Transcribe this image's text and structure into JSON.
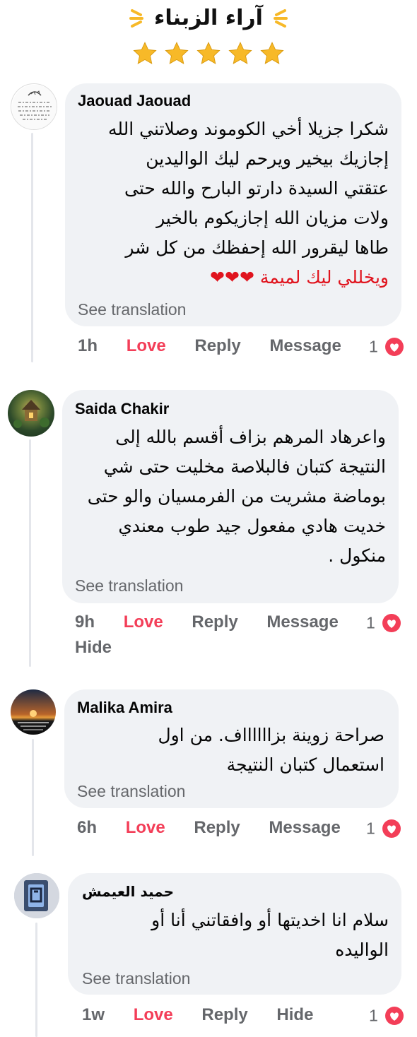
{
  "header": {
    "title": "آراء الزبناء",
    "rating": 5
  },
  "colors": {
    "bubble": "#f0f2f5",
    "love": "#f33e58",
    "meta": "#65676b",
    "star": "#f7b928"
  },
  "comments": [
    {
      "author": "Jaouad Jaouad",
      "lines": [
        "شكرا جزيلا أخي الكوموند وصلاتني الله",
        "إجازيك بيخير ويرحم ليك الواليدين",
        "عتقتي السيدة دارتو البارح والله حتى",
        "ولات مزيان الله إجازيكوم بالخير",
        "طاها ليقرور الله إحفظك من كل شر",
        "ويخللي ليك لميمة ❤❤❤"
      ],
      "see_translation": "See translation",
      "time": "1h",
      "love": "Love",
      "reply": "Reply",
      "message": "Message",
      "count": "1"
    },
    {
      "author": "Saida Chakir",
      "lines": [
        "واعرهاد المرهم بزاف أقسم بالله إلى",
        "النتيجة كتبان فالبلاصة مخليت حتى شي",
        "بوماضة مشريت من الفرمسيان والو حتى",
        "خديت هادي مفعول جيد طوب معندي",
        "منكول ."
      ],
      "see_translation": "See translation",
      "time": "9h",
      "love": "Love",
      "reply": "Reply",
      "message": "Message",
      "hide": "Hide",
      "count": "1"
    },
    {
      "author": "Malika Amira",
      "lines": [
        "صراحة زوينة بزااااااف. من اول",
        "استعمال كتبان النتيجة"
      ],
      "see_translation": "See translation",
      "time": "6h",
      "love": "Love",
      "reply": "Reply",
      "message": "Message",
      "count": "1"
    },
    {
      "author": "حميد العيمش",
      "lines": [
        "سلام انا اخديتها أو وافقاتني أنا أو",
        "الواليده"
      ],
      "see_translation": "See translation",
      "time": "1w",
      "love": "Love",
      "reply": "Reply",
      "hide": "Hide",
      "count": "1"
    }
  ]
}
